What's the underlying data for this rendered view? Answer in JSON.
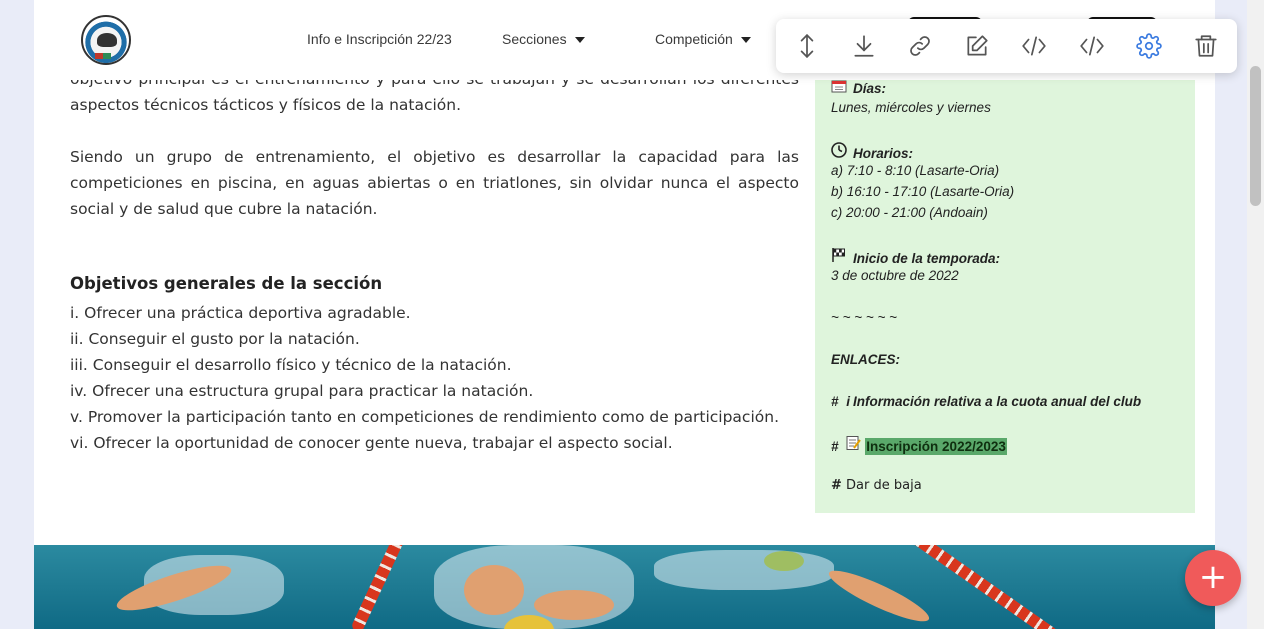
{
  "nav": {
    "items": [
      {
        "label": "Info e Inscripción 22/23",
        "dropdown": false
      },
      {
        "label": "Secciones",
        "dropdown": true
      },
      {
        "label": "Competición",
        "dropdown": true
      }
    ]
  },
  "toolbar": {
    "buttons": [
      "move-vertical-icon",
      "download-icon",
      "link-icon",
      "edit-icon",
      "code-icon",
      "code-alt-icon",
      "gear-icon",
      "trash-icon"
    ],
    "active_color": "#3b7be0"
  },
  "main": {
    "para1": "objetivo principal es el entrenamiento y para ello se trabajan y se desarrollan los diferentes aspectos técnicos tácticos y físicos de la natación.",
    "para2": "Siendo un grupo de entrenamiento, el objetivo es desarrollar la capacidad para las competiciones en piscina, en aguas abiertas o en triatlones, sin olvidar nunca el aspecto social y de salud que cubre la natación.",
    "objectives_title": "Objetivos generales de la sección",
    "objectives": [
      "i. Ofrecer una práctica deportiva agradable.",
      "ii. Conseguir el gusto por la natación.",
      "iii. Conseguir el desarrollo físico y técnico de la natación.",
      "iv. Ofrecer una estructura grupal para practicar la natación.",
      "v. Promover la participación tanto en competiciones de rendimiento como de participación.",
      "vi. Ofrecer la oportunidad de conocer gente nueva, trabajar el aspecto social."
    ]
  },
  "sidebar": {
    "dias_label": "Días:",
    "dias_value": "Lunes, miércoles y viernes",
    "horarios_label": "Horarios:",
    "horarios": [
      "a) 7:10 - 8:10 (Lasarte-Oria)",
      "b) 16:10 - 17:10 (Lasarte-Oria)",
      "c) 20:00 - 21:00 (Andoain)"
    ],
    "inicio_label": "Inicio de la temporada:",
    "inicio_value": "3 de octubre de 2022",
    "divider": "~ ~ ~ ~ ~ ~",
    "enlaces": "ENLACES:",
    "link_cuota": "Información relativa a la cuota anual del club",
    "link_inscripcion": "Inscripción 2022/2023",
    "link_baja": "Dar de baja",
    "hash": "#",
    "info_char": "i",
    "bg_color": "#dff5dc",
    "highlight_color": "#5aa86a"
  },
  "fab": {
    "label": "+"
  }
}
